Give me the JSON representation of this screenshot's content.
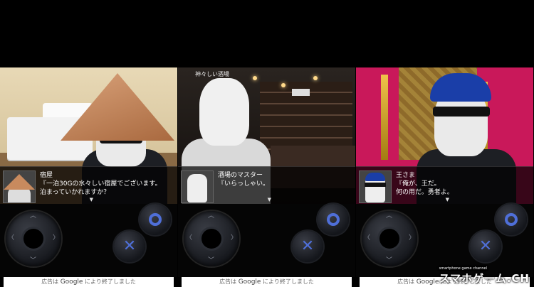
{
  "panels": [
    {
      "location": "",
      "speaker": "宿屋",
      "lines": [
        "『一泊30Gの水々しい宿屋でございます。",
        "泊まっていかれますか？",
        ""
      ],
      "next": "▼"
    },
    {
      "location": "神々しい酒場",
      "speaker": "酒場のマスター",
      "lines": [
        "『いらっしゃい。",
        "",
        ""
      ],
      "next": "▼"
    },
    {
      "location": "",
      "speaker": "王さま",
      "lines": [
        "『俺が、王だ。",
        "何の用だ。勇者よ。",
        ""
      ],
      "next": "▼"
    }
  ],
  "controls": {
    "dpad_up": "︿",
    "dpad_down": "﹀",
    "dpad_left": "〈",
    "dpad_right": "〉",
    "o_button": "",
    "x_button": "✕"
  },
  "ad": {
    "prefix": "広告は",
    "brand": "Google",
    "suffix": "により終了しました"
  },
  "watermark": {
    "main": "スマホゲーム.CH",
    "sub": "smartphone game channel"
  },
  "colors": {
    "button_glyph": "#4f6fd8",
    "room_wall": "#e8d9b6",
    "throne_wall": "#c9185a"
  }
}
